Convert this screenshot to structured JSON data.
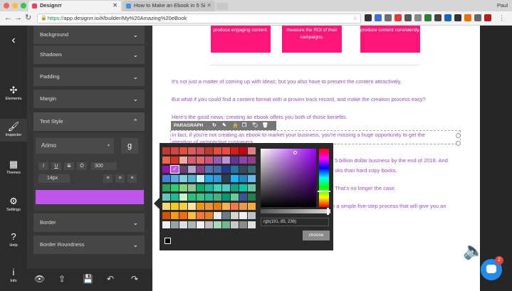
{
  "browser": {
    "tabs": [
      {
        "title": "Designrr",
        "favicon_color": "#e8425a"
      },
      {
        "title": "How to Make an Ebook in 5 Si",
        "favicon_color": "#4a90e2"
      }
    ],
    "user": "Paul",
    "url": "https://app.designrr.io/#/builder/My%20Amazing%20eBook",
    "url_scheme": "https://",
    "url_rest": "app.designrr.io/#/builder/My%20Amazing%20eBook"
  },
  "leftnav": {
    "items": [
      {
        "label": "Elements",
        "icon": "puzzle-icon"
      },
      {
        "label": "Inspector",
        "icon": "brush-icon"
      },
      {
        "label": "Themes",
        "icon": "layers-icon"
      },
      {
        "label": "Settings",
        "icon": "gear-icon"
      },
      {
        "label": "Help",
        "icon": "help-icon"
      },
      {
        "label": "Info",
        "icon": "info-icon"
      }
    ]
  },
  "inspector": {
    "rows": [
      "Background",
      "Shadows",
      "Padding",
      "Margin",
      "Text Style",
      "Border",
      "Border Roundness"
    ],
    "font": "Arimo",
    "format_buttons": [
      "I",
      "U",
      "S",
      "Ö"
    ],
    "weight": "300",
    "size": "14px",
    "selected_color": "#bf55ec"
  },
  "content": {
    "pink_boxes": [
      "produce engaging content.",
      "measure the ROI of their campaigns.",
      "produce content consistently."
    ],
    "paragraphs": [
      "It's not just a matter of coming up with ideas; but you also have to present the content attractively.",
      "But what if you could find a content format with a proven track record, and make the creation process easy?",
      "Here's the good news: creating an ebook offers you both of those benefits.",
      "In fact, if you're not creating an ebook to market your business, you're missing a huge opportunity to get the",
      "attention of prospective customers.",
      "5 billion dollar business by the end of 2018. And",
      "oks than hard copy books.",
      "That's no longer the case.",
      "n a simple five-step process that will give you an"
    ],
    "toolbar_label": "PARAGRAPH",
    "text_color": "#a24bd6",
    "accent_pink": "#ff1677"
  },
  "color_picker": {
    "rgb_value": "rgb(191, 85, 236)",
    "choose_label": "choose",
    "palette": [
      [
        "#c0392b",
        "#d64541",
        "#e74c3c",
        "#e05a5a",
        "#d24d57",
        "#c0392b",
        "#e74c3c",
        "#f64747",
        "#d91e18",
        "#cf000f",
        "#e08283"
      ],
      [
        "#ec644b",
        "#dc3023",
        "#f1a9a0",
        "#db5a6b",
        "#e26a6a",
        "#d2527f",
        "#9b59b6",
        "#be90d4",
        "#663399",
        "#8e44ad",
        "#913d88"
      ],
      [
        "#9a12b3",
        "#bf55ec",
        "#674172",
        "#aea8d3",
        "#913d88",
        "#4b77be",
        "#446cb3",
        "#1f3a93",
        "#2574a9",
        "#34495e",
        "#336e7b"
      ],
      [
        "#4183d7",
        "#59abe3",
        "#81cfe0",
        "#52b3d9",
        "#c5eff7",
        "#22a7f0",
        "#3498db",
        "#2c3e50",
        "#19b5fe",
        "#1e8bc3",
        "#6bb9f0"
      ],
      [
        "#26a65b",
        "#2ecc71",
        "#87d37c",
        "#90c695",
        "#00b16a",
        "#1bbc9b",
        "#36d7b7",
        "#4ecdc4",
        "#16a085",
        "#03c9a9",
        "#68c3a3"
      ],
      [
        "#65c6bb",
        "#1abc9c",
        "#c8f7c5",
        "#26c281",
        "#3fc380",
        "#2abb9b",
        "#4daf7c",
        "#019875",
        "#66cc99",
        "#3a539b",
        "#1e824c"
      ],
      [
        "#f5d76e",
        "#f7ca18",
        "#f4d03f",
        "#fde3a7",
        "#f89406",
        "#eb9532",
        "#e87e04",
        "#f4b350",
        "#f2784b",
        "#eb974e",
        "#f5ab35"
      ],
      [
        "#d35400",
        "#f39c12",
        "#f9690e",
        "#f9bf3b",
        "#f27935",
        "#e67e22",
        "#ececec",
        "#6c7a89",
        "#d2d7d3",
        "#eeeeee",
        "#bdc3c7"
      ],
      [
        "#ecf0f1",
        "#95a5a6",
        "#dadfe1",
        "#abb7b7",
        "#f2f1ef",
        "#bfbfbf",
        "#a8d8b9",
        "#6fb98f",
        "#c9c9c9",
        "#8c8c8c",
        "#e0e0e0"
      ]
    ]
  }
}
